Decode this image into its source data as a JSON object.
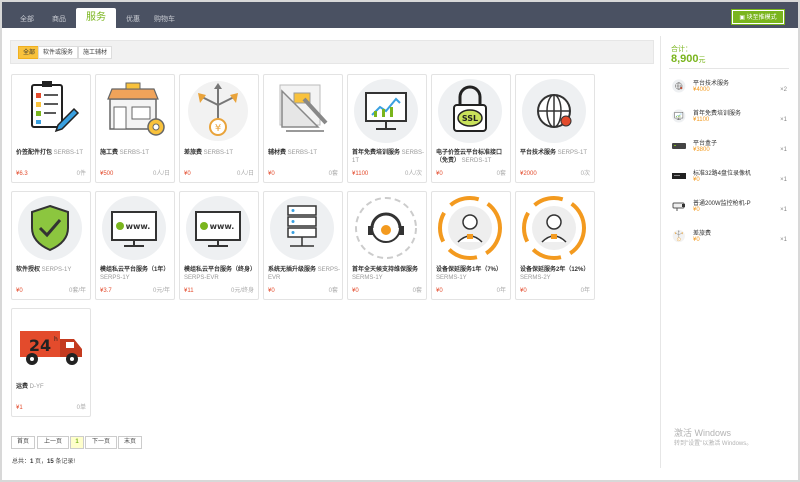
{
  "topbar": {
    "tabs": [
      {
        "label": "全部"
      },
      {
        "label": "商品"
      },
      {
        "label": "服务"
      },
      {
        "label": "优惠"
      },
      {
        "label": "购物车"
      }
    ],
    "active_index": 2,
    "switch_label": "块至推模式"
  },
  "subtabs": [
    {
      "label": "全部"
    },
    {
      "label": "软件或服务"
    },
    {
      "label": "施工辅材"
    }
  ],
  "products": [
    {
      "name": "价签配件打包",
      "code": "SERBS-1T",
      "price": "¥6.3",
      "stock": "0件",
      "icon": "clipboard-checklist-icon"
    },
    {
      "name": "施工费",
      "code": "SERBS-1T",
      "price": "¥500",
      "stock": "0人/日",
      "icon": "shop-icon"
    },
    {
      "name": "差旅费",
      "code": "SERBS-1T",
      "price": "¥0",
      "stock": "0人/日",
      "icon": "travel-expense-icon"
    },
    {
      "name": "辅材费",
      "code": "SERBS-1T",
      "price": "¥0",
      "stock": "0套",
      "icon": "drafting-tools-icon"
    },
    {
      "name": "首年免费培训服务",
      "code": "SERBS-1T",
      "price": "¥1100",
      "stock": "0人/次",
      "icon": "monitor-chart-icon"
    },
    {
      "name": "电子价签云平台标准接口（免责）",
      "code": "SERDS-1T",
      "price": "¥0",
      "stock": "0套",
      "icon": "ssl-lock-icon"
    },
    {
      "name": "平台技术服务",
      "code": "SERPS-1T",
      "price": "¥2000",
      "stock": "0次",
      "icon": "globe-icon"
    },
    {
      "name": "软件授权",
      "code": "SERPS-1Y",
      "price": "¥0",
      "stock": "0套/年",
      "icon": "shield-check-icon"
    },
    {
      "name": "模组私云平台服务（1年）",
      "code": "SERPS-1Y",
      "price": "¥3.7",
      "stock": "0元/年",
      "icon": "www-monitor-icon"
    },
    {
      "name": "模组私云平台服务（终身）",
      "code": "SERPS-EVR",
      "price": "¥11",
      "stock": "0元/终身",
      "icon": "www-monitor-icon"
    },
    {
      "name": "系统无插升级服务",
      "code": "SERPS-EVR",
      "price": "¥0",
      "stock": "0套",
      "icon": "server-icon"
    },
    {
      "name": "首年全天候支持维保服务",
      "code": "SERMS-1Y",
      "price": "¥0",
      "stock": "0套",
      "icon": "headset-support-icon"
    },
    {
      "name": "设备保延服务1年（7%）",
      "code": "SERMS-1Y",
      "price": "¥0",
      "stock": "0年",
      "icon": "service-person-icon"
    },
    {
      "name": "设备保延服务2年（12%）",
      "code": "SERMS-2Y",
      "price": "¥0",
      "stock": "0年",
      "icon": "service-person-icon"
    },
    {
      "name": "运费",
      "code": "D-YF",
      "price": "¥1",
      "stock": "0单",
      "icon": "delivery-truck-icon"
    }
  ],
  "pager": {
    "first": "首页",
    "prev": "上一页",
    "current": "1",
    "next": "下一页",
    "last": "末页"
  },
  "summary": {
    "prefix": "总共：",
    "pages": "1",
    "mid": " 页，",
    "records": "15",
    "suffix": " 条记录!"
  },
  "cart": {
    "total_label": "合计：",
    "total_value": "8,900",
    "total_unit": "元",
    "items": [
      {
        "name": "平台技术服务",
        "price": "¥4000",
        "qty": "×2",
        "icon": "globe-icon"
      },
      {
        "name": "首年免费培训服务",
        "price": "¥1100",
        "qty": "×1",
        "icon": "monitor-chart-icon"
      },
      {
        "name": "平台盒子",
        "price": "¥3800",
        "qty": "×1",
        "icon": "platform-box-icon"
      },
      {
        "name": "标准32路4盘位录像机",
        "price": "¥0",
        "qty": "×1",
        "icon": "nvr-device-icon"
      },
      {
        "name": "普通200W监控枪机-P",
        "price": "¥0",
        "qty": "×1",
        "icon": "bullet-camera-icon"
      },
      {
        "name": "差旅费",
        "price": "¥0",
        "qty": "×1",
        "icon": "travel-expense-icon"
      }
    ]
  },
  "watermark": {
    "line1": "激活 Windows",
    "line2": "转到\"设置\"以激活 Windows。"
  },
  "colors": {
    "accent": "#7ab51d",
    "topbar": "#4a5162",
    "price": "#e34b2c",
    "cart_price": "#f39a1f",
    "subtab_active": "#f9c23c"
  }
}
